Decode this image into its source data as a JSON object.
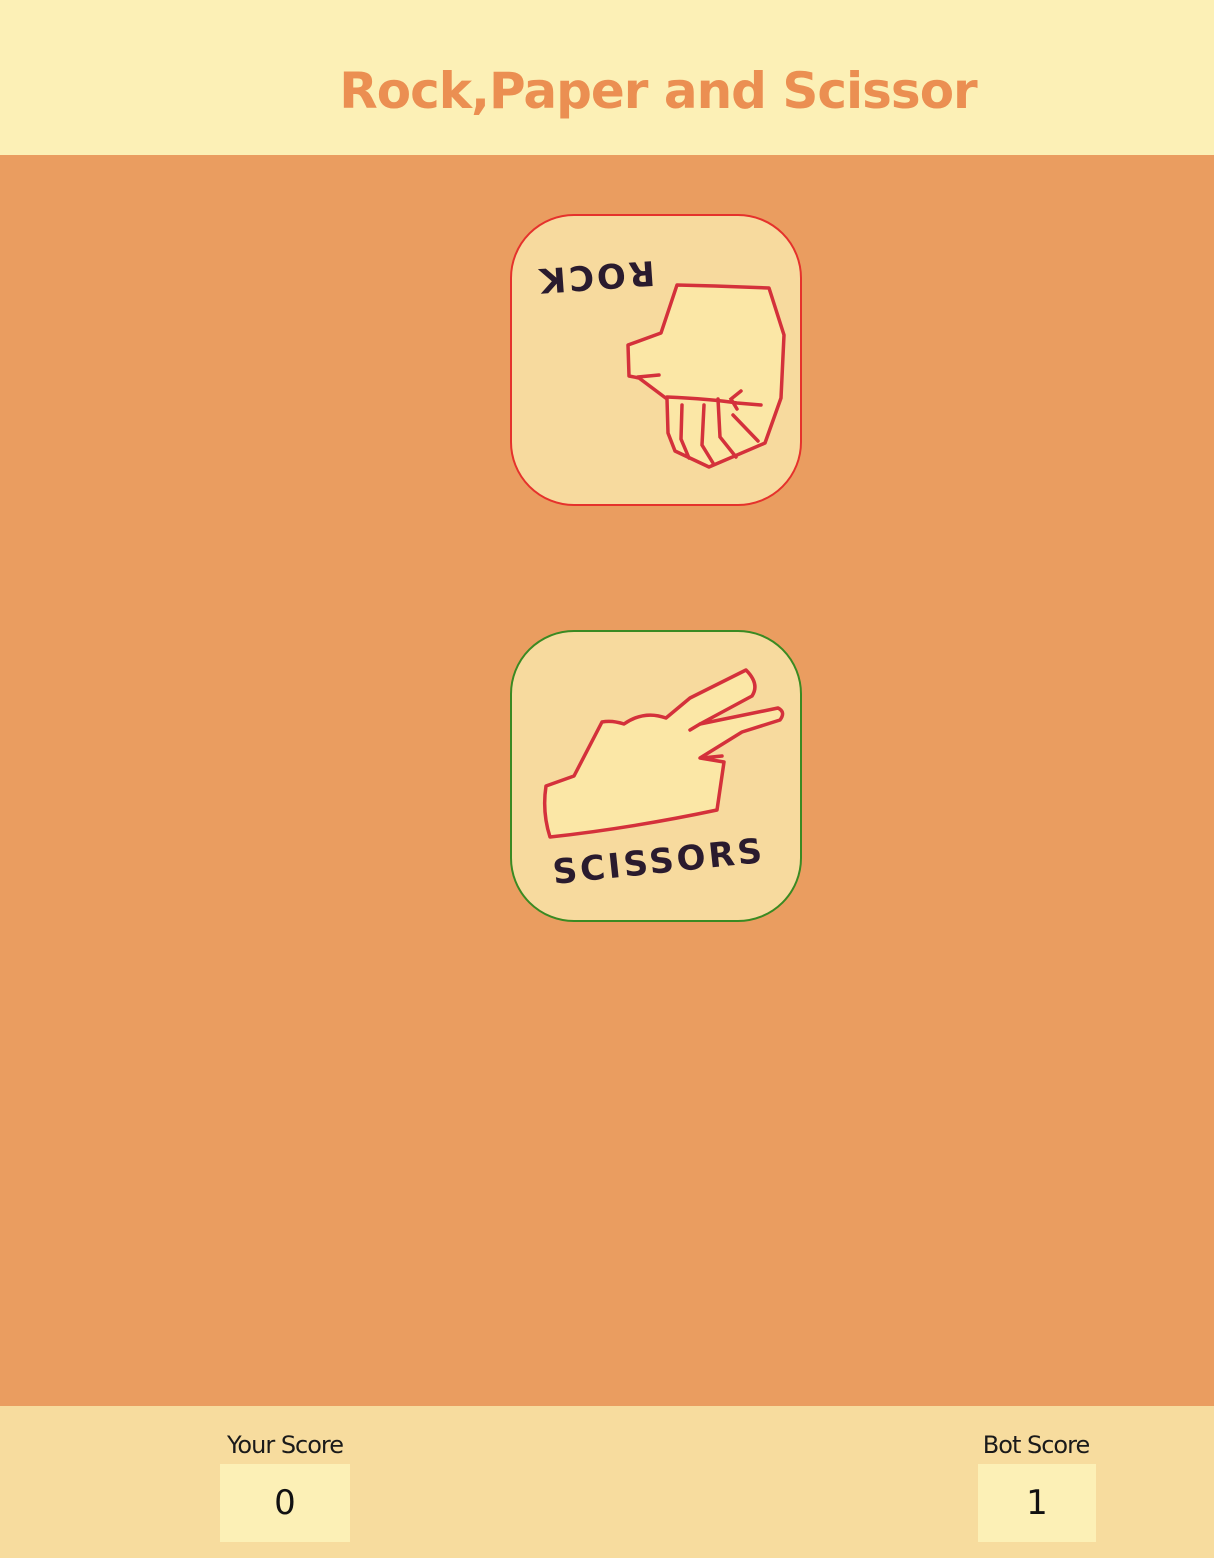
{
  "header": {
    "title": "Rock,Paper and Scissor"
  },
  "game": {
    "bot_choice": {
      "label": "ROCK",
      "icon": "rock-fist-icon",
      "result_color": "#e5322c"
    },
    "player_choice": {
      "label": "SCISSORS",
      "icon": "scissors-hand-icon",
      "result_color": "#3a8a22"
    }
  },
  "scores": {
    "player": {
      "label": "Your Score",
      "value": "0"
    },
    "bot": {
      "label": "Bot Score",
      "value": "1"
    }
  },
  "colors": {
    "header_bg": "#fcf0b6",
    "stage_bg": "#ea9d60",
    "footer_bg": "#f7dc9e",
    "title": "#eb8f52",
    "hand_stroke": "#d4313b",
    "card_bg": "#f7da9e"
  }
}
